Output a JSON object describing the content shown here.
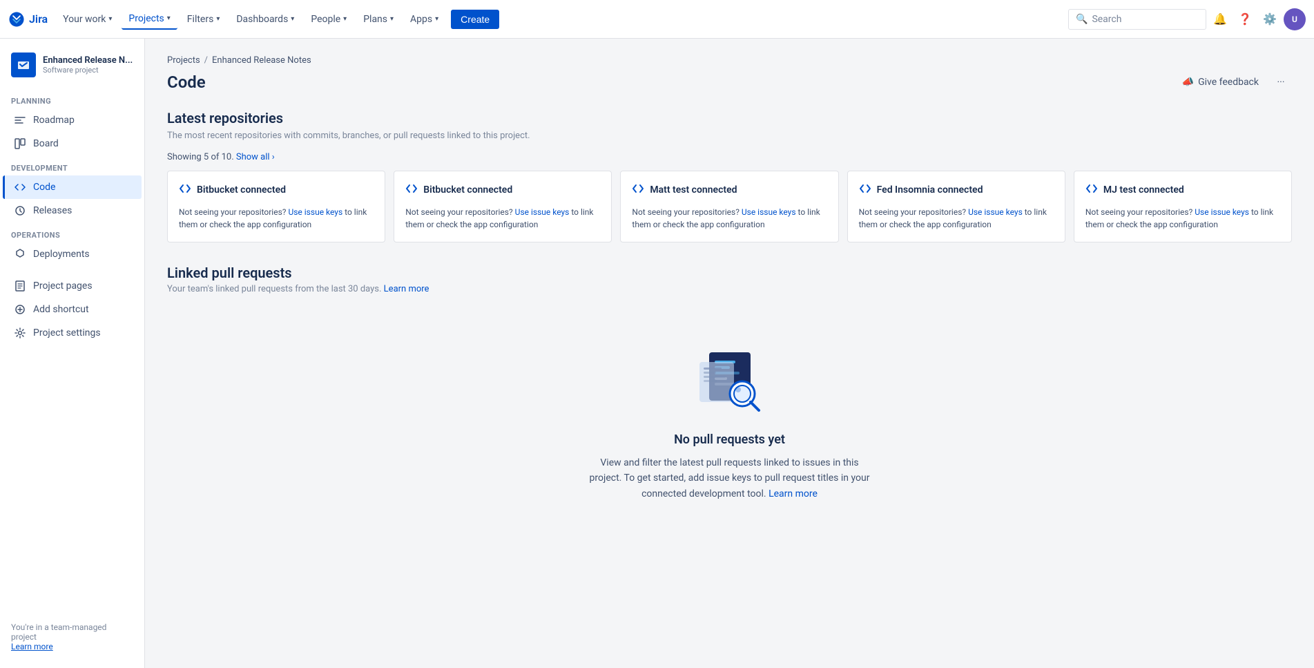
{
  "topnav": {
    "logo_text": "Jira",
    "items": [
      {
        "label": "Your work",
        "has_chevron": true,
        "active": false
      },
      {
        "label": "Projects",
        "has_chevron": true,
        "active": true
      },
      {
        "label": "Filters",
        "has_chevron": true,
        "active": false
      },
      {
        "label": "Dashboards",
        "has_chevron": true,
        "active": false
      },
      {
        "label": "People",
        "has_chevron": true,
        "active": false
      },
      {
        "label": "Plans",
        "has_chevron": true,
        "active": false
      },
      {
        "label": "Apps",
        "has_chevron": true,
        "active": false
      }
    ],
    "create_label": "Create",
    "search_placeholder": "Search"
  },
  "sidebar": {
    "project_name": "Enhanced Release N...",
    "project_type": "Software project",
    "planning_label": "PLANNING",
    "planning_items": [
      {
        "icon": "roadmap",
        "label": "Roadmap"
      },
      {
        "icon": "board",
        "label": "Board"
      }
    ],
    "development_label": "DEVELOPMENT",
    "development_items": [
      {
        "icon": "code",
        "label": "Code",
        "active": true
      },
      {
        "icon": "releases",
        "label": "Releases"
      }
    ],
    "operations_label": "OPERATIONS",
    "operations_items": [
      {
        "icon": "deployments",
        "label": "Deployments"
      }
    ],
    "misc_items": [
      {
        "icon": "pages",
        "label": "Project pages"
      },
      {
        "icon": "shortcut",
        "label": "Add shortcut"
      },
      {
        "icon": "settings",
        "label": "Project settings"
      }
    ],
    "team_note": "You're in a team-managed project",
    "learn_more": "Learn more"
  },
  "breadcrumb": {
    "items": [
      "Projects",
      "Enhanced Release Notes"
    ]
  },
  "page": {
    "title": "Code",
    "give_feedback_label": "Give feedback",
    "more_label": "···"
  },
  "latest_repos": {
    "title": "Latest repositories",
    "subtitle": "The most recent repositories with commits, branches, or pull requests linked to this project.",
    "showing_text": "Showing 5 of 10.",
    "show_all_label": "Show all ›",
    "cards": [
      {
        "title": "Bitbucket connected",
        "body": "Not seeing your repositories?",
        "link_text": "Use issue keys",
        "body2": "to link them or check the app configuration"
      },
      {
        "title": "Bitbucket connected",
        "body": "Not seeing your repositories?",
        "link_text": "Use issue keys",
        "body2": "to link them or check the app configuration"
      },
      {
        "title": "Matt test connected",
        "body": "Not seeing your repositories?",
        "link_text": "Use issue keys",
        "body2": "to link them or check the app configuration"
      },
      {
        "title": "Fed Insomnia connected",
        "body": "Not seeing your repositories?",
        "link_text": "Use issue keys",
        "body2": "to link them or check the app configuration"
      },
      {
        "title": "MJ test connected",
        "body": "Not seeing your repositories?",
        "link_text": "Use issue keys",
        "body2": "to link them or check the app configuration"
      }
    ]
  },
  "pull_requests": {
    "title": "Linked pull requests",
    "subtitle": "Your team's linked pull requests from the last 30 days.",
    "learn_more_label": "Learn more",
    "empty_title": "No pull requests yet",
    "empty_desc": "View and filter the latest pull requests linked to issues in this project. To get started, add issue keys to pull request titles in your connected development tool.",
    "empty_learn_more": "Learn more"
  }
}
